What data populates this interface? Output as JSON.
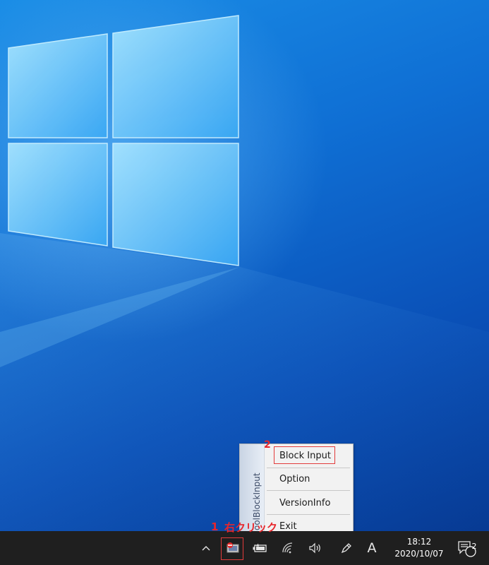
{
  "context_menu": {
    "sidebar_title": "oolBlockInput",
    "items": [
      {
        "label": "Block Input"
      },
      {
        "label": "Option"
      },
      {
        "label": "VersionInfo"
      },
      {
        "label": "Exit"
      }
    ]
  },
  "annotations": {
    "step1_number": "1",
    "step1_text": "右クリック",
    "step2_number": "2"
  },
  "taskbar": {
    "tray_icons": [
      {
        "name": "chevron-up-icon"
      },
      {
        "name": "block-input-tray-icon"
      },
      {
        "name": "battery-icon"
      },
      {
        "name": "wifi-icon"
      },
      {
        "name": "volume-icon"
      },
      {
        "name": "pen-icon"
      },
      {
        "name": "ime-icon",
        "label": "A"
      }
    ],
    "clock_time": "18:12",
    "clock_date": "2020/10/07",
    "notification_count": "2"
  },
  "colors": {
    "annotation_red": "#e8262b",
    "taskbar_bg": "#1f1f1f",
    "desktop_blue": "#0f6fd4"
  }
}
